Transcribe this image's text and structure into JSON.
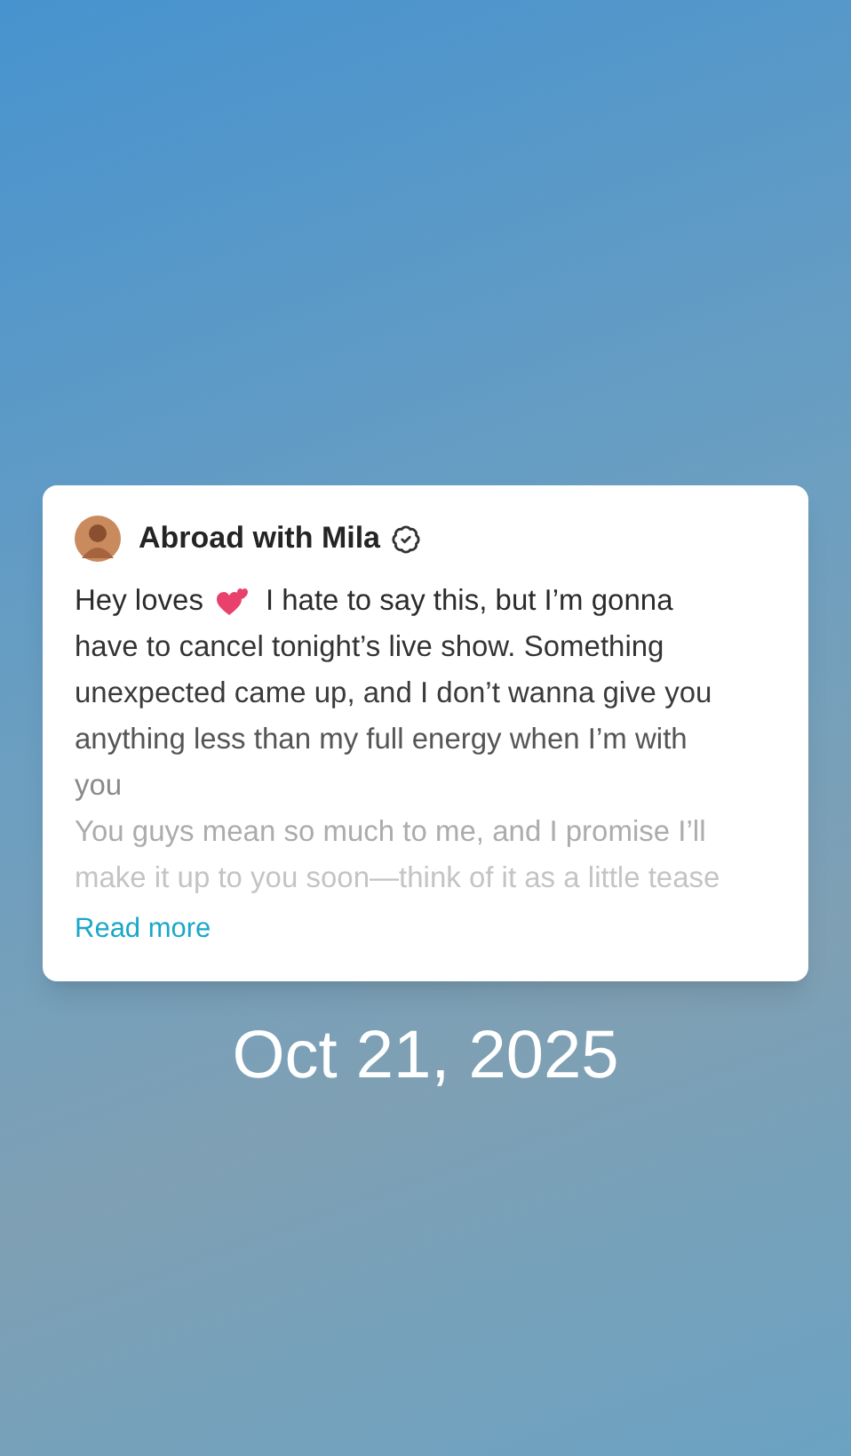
{
  "post": {
    "author": "Abroad with Mila",
    "verified": true,
    "lines": [
      {
        "parts": [
          "Hey loves",
          "I hate to say this, but I’m gonna"
        ]
      },
      {
        "parts": [
          "have to cancel tonight’s live show. Something"
        ]
      },
      {
        "parts": [
          "unexpected came up, and I don’t wanna give you"
        ]
      },
      {
        "parts": [
          "anything less than my full energy when I’m with"
        ]
      },
      {
        "parts": [
          "you"
        ]
      },
      {
        "parts": [
          "You guys mean so much to me, and I promise I’ll"
        ]
      },
      {
        "parts": [
          "make it up to you soon—think of it as a little tease"
        ]
      }
    ],
    "read_more": "Read more"
  },
  "date": "Oct 21, 2025"
}
